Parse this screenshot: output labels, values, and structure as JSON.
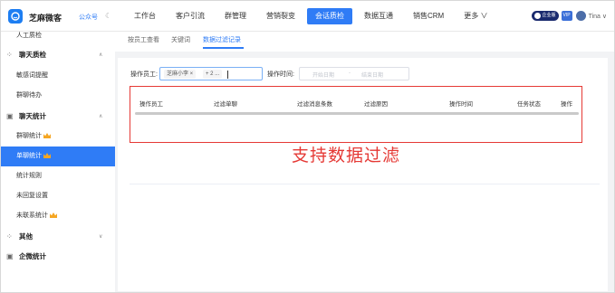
{
  "app": {
    "brand": "芝麻微客",
    "gzh_label": "公众号",
    "moon_glyph": "☾"
  },
  "nav": {
    "items": [
      {
        "label": "工作台"
      },
      {
        "label": "客户引流"
      },
      {
        "label": "群管理"
      },
      {
        "label": "营销裂变"
      },
      {
        "label": "会话质检",
        "active": true
      },
      {
        "label": "数据互通"
      },
      {
        "label": "销售CRM"
      },
      {
        "label": "更多 ∨"
      }
    ],
    "active_color": "#2f7cf6"
  },
  "user": {
    "badge1": "企业版",
    "badge2": "VIP",
    "name": "Tina ∨"
  },
  "sidebar": {
    "top_item": "人工质检",
    "groups": [
      {
        "label": "聊天质检",
        "icon": "chat-inspect-icon",
        "glyph": "⁘",
        "arrow": "∧",
        "items": [
          "敏感词提醒",
          "群聊待办"
        ]
      },
      {
        "label": "聊天统计",
        "icon": "stats-icon",
        "glyph": "▣",
        "arrow": "∧",
        "items": [
          "群聊统计",
          "单聊统计",
          "统计规则",
          "未回复设置",
          "未联系统计"
        ]
      },
      {
        "label": "其他",
        "icon": "other-icon",
        "glyph": "⁘",
        "arrow": "∨",
        "items": []
      },
      {
        "label": "企微统计",
        "icon": "wecom-stats-icon",
        "glyph": "▣",
        "arrow": "",
        "items": []
      }
    ],
    "active_item": "单聊统计"
  },
  "tabs": {
    "items": [
      "按员工查看",
      "关键词",
      "数据过滤记录"
    ],
    "active": "数据过滤记录"
  },
  "filters": {
    "staff_label": "操作员工:",
    "staff_tag": "芝麻小李 ×",
    "staff_more": "+ 2 ...",
    "time_label": "操作时间:",
    "start_placeholder": "开始日期",
    "separator": "-",
    "end_placeholder": "结束日期"
  },
  "table": {
    "columns": [
      "操作员工",
      "过滤单聊",
      "过滤消息条数",
      "过滤原因",
      "操作时间",
      "任务状态",
      "操作"
    ]
  },
  "overlay_text": "支持数据过滤",
  "colors": {
    "primary": "#2f7cf6",
    "highlight_red": "#e53935",
    "crown": "#f5a623"
  }
}
